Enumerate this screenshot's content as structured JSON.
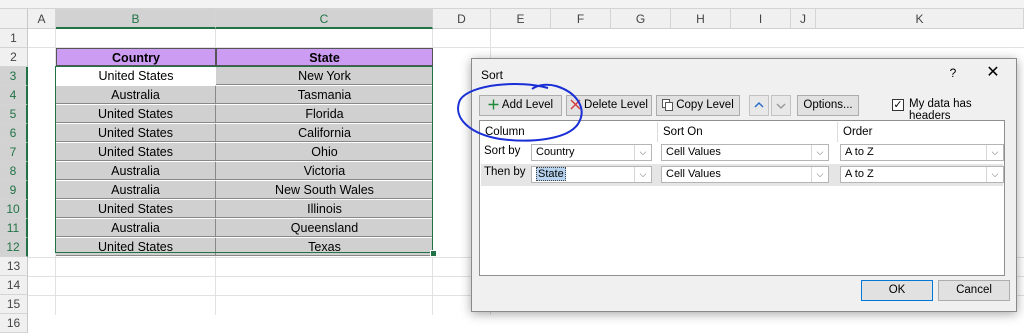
{
  "sheet": {
    "columns": [
      "A",
      "B",
      "C",
      "D",
      "E",
      "F",
      "G",
      "H",
      "I",
      "J",
      "K"
    ],
    "rows": [
      "1",
      "2",
      "3",
      "4",
      "5",
      "6",
      "7",
      "8",
      "9",
      "10",
      "11",
      "12",
      "13",
      "14",
      "15",
      "16"
    ],
    "headers": {
      "country": "Country",
      "state": "State"
    },
    "data": [
      {
        "country": "United States",
        "state": "New York"
      },
      {
        "country": "Australia",
        "state": "Tasmania"
      },
      {
        "country": "United States",
        "state": "Florida"
      },
      {
        "country": "United States",
        "state": "California"
      },
      {
        "country": "United States",
        "state": "Ohio"
      },
      {
        "country": "Australia",
        "state": "Victoria"
      },
      {
        "country": "Australia",
        "state": "New South Wales"
      },
      {
        "country": "United States",
        "state": "Illinois"
      },
      {
        "country": "Australia",
        "state": "Queensland"
      },
      {
        "country": "United States",
        "state": "Texas"
      }
    ],
    "colors": {
      "header_fill": "#cc9bf2",
      "data_fill": "#d0d0d0",
      "selection": "#217346"
    }
  },
  "dialog": {
    "title": "Sort",
    "help": "?",
    "close": "✕",
    "toolbar": {
      "add_level": "Add Level",
      "delete_level": "Delete Level",
      "copy_level": "Copy Level",
      "options": "Options...",
      "headers_checkbox": "My data has headers",
      "headers_checked": true
    },
    "columns": {
      "column": "Column",
      "sort_on": "Sort On",
      "order": "Order"
    },
    "levels": [
      {
        "label": "Sort by",
        "column": "Country",
        "sort_on": "Cell Values",
        "order": "A to Z"
      },
      {
        "label": "Then by",
        "column": "State",
        "sort_on": "Cell Values",
        "order": "A to Z"
      }
    ],
    "ok": "OK",
    "cancel": "Cancel"
  },
  "annotation": {
    "color": "#1a2fd6",
    "shape": "hand-drawn circle around Add Level"
  }
}
